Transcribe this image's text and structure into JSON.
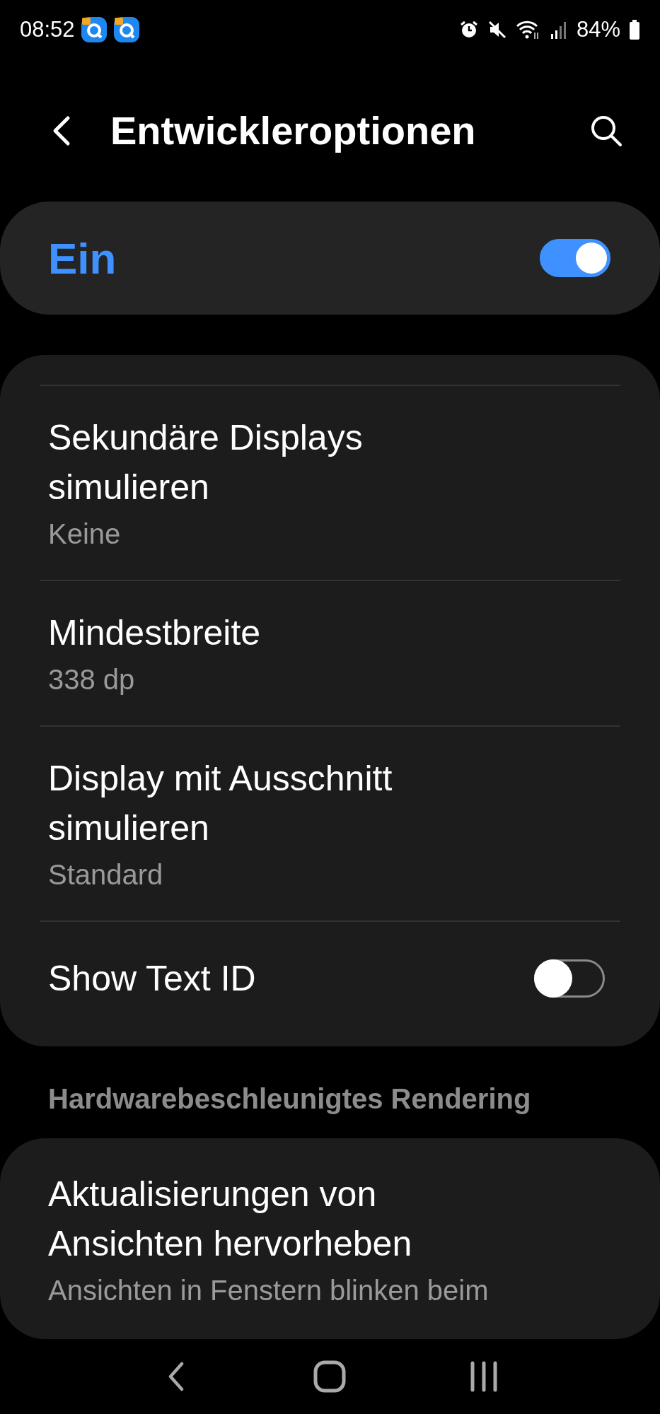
{
  "status_bar": {
    "time": "08:52",
    "battery": "84%"
  },
  "header": {
    "title": "Entwickleroptionen"
  },
  "master_switch": {
    "label": "Ein",
    "on": true
  },
  "settings": [
    {
      "kind": "entry",
      "title": "Sekundäre Displays simulieren",
      "summary": "Keine"
    },
    {
      "kind": "entry",
      "title": "Mindestbreite",
      "summary": "338 dp"
    },
    {
      "kind": "entry",
      "title": "Display mit Ausschnitt simulieren",
      "summary": "Standard"
    },
    {
      "kind": "switch",
      "title": "Show Text ID",
      "on": false
    }
  ],
  "section": {
    "title": "Hardwarebeschleunigtes Rendering",
    "settings": [
      {
        "kind": "entry",
        "title": "Aktualisierungen von Ansichten hervorheben",
        "summary": "Ansichten in Fenstern blinken beim"
      }
    ]
  }
}
